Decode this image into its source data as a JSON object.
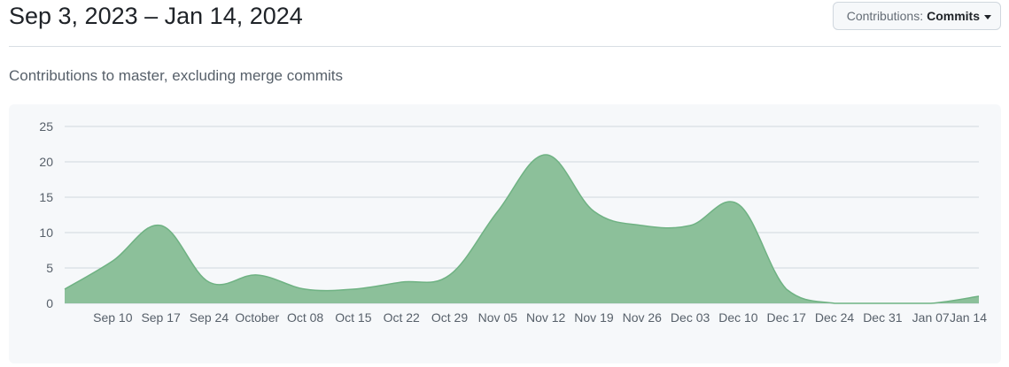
{
  "header": {
    "title": "Sep 3, 2023 – Jan 14, 2024",
    "select_label": "Contributions:",
    "select_value": "Commits"
  },
  "subtitle": "Contributions to master, excluding merge commits",
  "colors": {
    "area_fill": "#8cc09a",
    "area_stroke": "#6fb283",
    "grid": "#d0d7de",
    "chart_background": "#f6f8fa"
  },
  "chart_data": {
    "type": "area",
    "title": "",
    "xlabel": "",
    "ylabel": "",
    "ylim": [
      0,
      25
    ],
    "yticks": [
      "0",
      "5",
      "10",
      "15",
      "20",
      "25"
    ],
    "x": [
      "2023-09-03",
      "2023-09-10",
      "2023-09-17",
      "2023-09-24",
      "2023-10-01",
      "2023-10-08",
      "2023-10-15",
      "2023-10-22",
      "2023-10-29",
      "2023-11-05",
      "2023-11-12",
      "2023-11-19",
      "2023-11-26",
      "2023-12-03",
      "2023-12-10",
      "2023-12-17",
      "2023-12-24",
      "2023-12-31",
      "2024-01-07",
      "2024-01-14"
    ],
    "xtick_labels": [
      "Sep 10",
      "Sep 17",
      "Sep 24",
      "October",
      "Oct 08",
      "Oct 15",
      "Oct 22",
      "Oct 29",
      "Nov 05",
      "Nov 12",
      "Nov 19",
      "Nov 26",
      "Dec 03",
      "Dec 10",
      "Dec 17",
      "Dec 24",
      "Dec 31",
      "Jan 07",
      "Jan 14"
    ],
    "series": [
      {
        "values": [
          2,
          6,
          11,
          3,
          4,
          2,
          2,
          3,
          4,
          13,
          21,
          13,
          11,
          11,
          14,
          2,
          0,
          0,
          0,
          1
        ]
      }
    ],
    "grid": true,
    "legend": "none"
  }
}
